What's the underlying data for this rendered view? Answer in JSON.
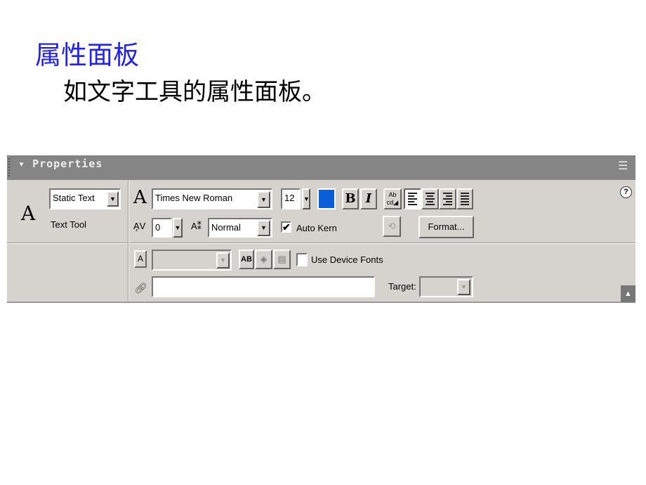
{
  "slide": {
    "title": "属性面板",
    "subtitle": "如文字工具的属性面板。"
  },
  "panel": {
    "title": "Properties",
    "text_type": "Static Text",
    "tool_label": "Text Tool",
    "font": "Times New Roman",
    "font_size": "12",
    "text_color": "#0a5ed8",
    "bold_label": "B",
    "italic_label": "I",
    "char_spacing": "0",
    "char_position": "Normal",
    "auto_kern_label": "Auto Kern",
    "auto_kern_checked": true,
    "format_label": "Format...",
    "use_device_fonts_label": "Use Device Fonts",
    "use_device_fonts_checked": false,
    "url_value": "",
    "target_label": "Target:",
    "help_label": "?"
  }
}
